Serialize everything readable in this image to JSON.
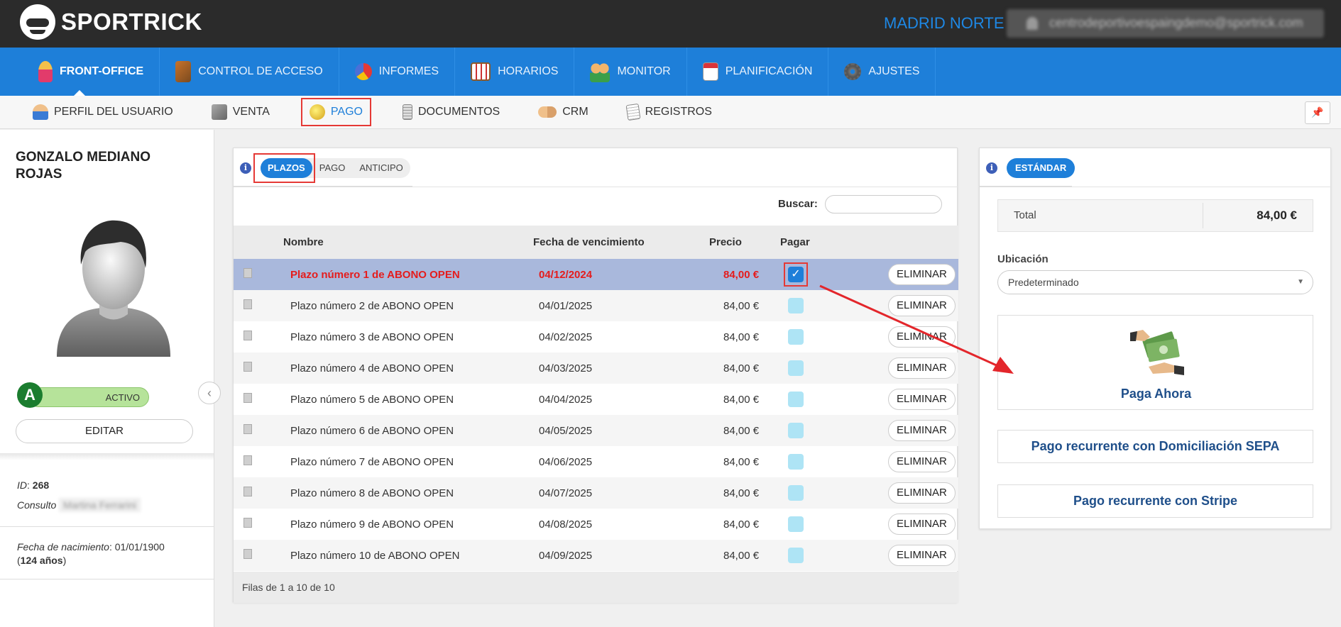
{
  "brand": {
    "name": "SPORTRICK"
  },
  "header": {
    "center_name": "MADRID NORTE",
    "user_email": "centrodeportivoespaingdemo@sportrick.com"
  },
  "main_nav": [
    {
      "label": "FRONT-OFFICE",
      "icon": "user-icon",
      "active": true
    },
    {
      "label": "CONTROL DE ACCESO",
      "icon": "turnstile-icon",
      "active": false
    },
    {
      "label": "INFORMES",
      "icon": "pie-chart-icon",
      "active": false
    },
    {
      "label": "HORARIOS",
      "icon": "calendar-grid-icon",
      "active": false
    },
    {
      "label": "MONITOR",
      "icon": "people-icon",
      "active": false
    },
    {
      "label": "PLANIFICACIÓN",
      "icon": "calendar-icon",
      "active": false
    },
    {
      "label": "AJUSTES",
      "icon": "gear-icon",
      "active": false
    }
  ],
  "sub_nav": [
    {
      "label": "PERFIL DEL USUARIO",
      "icon": "user-icon",
      "active": false
    },
    {
      "label": "VENTA",
      "icon": "cash-register-icon",
      "active": false
    },
    {
      "label": "PAGO",
      "icon": "coin-icon",
      "active": true
    },
    {
      "label": "DOCUMENTOS",
      "icon": "document-icon",
      "active": false
    },
    {
      "label": "CRM",
      "icon": "handshake-icon",
      "active": false
    },
    {
      "label": "REGISTROS",
      "icon": "notepad-icon",
      "active": false
    }
  ],
  "sidebar": {
    "name": "GONZALO MEDIANO ROJAS",
    "status_letter": "A",
    "status_label": "ACTIVO",
    "edit_label": "EDITAR",
    "id_label": "ID",
    "id_value": "268",
    "consultor_label": "Consulto",
    "consultor_value": "Martina Ferrarini",
    "birth_label": "Fecha de nacimiento",
    "birth_value": "01/01/1900",
    "age_value": "124 años"
  },
  "payments": {
    "tabs": [
      "PLAZOS",
      "PAGO",
      "ANTICIPO"
    ],
    "search_label": "Buscar:",
    "columns": [
      "Nombre",
      "Fecha de vencimiento",
      "Precio",
      "Pagar"
    ],
    "delete_label": "ELIMINAR",
    "rows": [
      {
        "name": "Plazo número 1 de ABONO OPEN",
        "due": "04/12/2024",
        "price": "84,00 €",
        "selected": true
      },
      {
        "name": "Plazo número 2 de ABONO OPEN",
        "due": "04/01/2025",
        "price": "84,00 €",
        "selected": false
      },
      {
        "name": "Plazo número 3 de ABONO OPEN",
        "due": "04/02/2025",
        "price": "84,00 €",
        "selected": false
      },
      {
        "name": "Plazo número 4 de ABONO OPEN",
        "due": "04/03/2025",
        "price": "84,00 €",
        "selected": false
      },
      {
        "name": "Plazo número 5 de ABONO OPEN",
        "due": "04/04/2025",
        "price": "84,00 €",
        "selected": false
      },
      {
        "name": "Plazo número 6 de ABONO OPEN",
        "due": "04/05/2025",
        "price": "84,00 €",
        "selected": false
      },
      {
        "name": "Plazo número 7 de ABONO OPEN",
        "due": "04/06/2025",
        "price": "84,00 €",
        "selected": false
      },
      {
        "name": "Plazo número 8 de ABONO OPEN",
        "due": "04/07/2025",
        "price": "84,00 €",
        "selected": false
      },
      {
        "name": "Plazo número 9 de ABONO OPEN",
        "due": "04/08/2025",
        "price": "84,00 €",
        "selected": false
      },
      {
        "name": "Plazo número 10 de ABONO OPEN",
        "due": "04/09/2025",
        "price": "84,00 €",
        "selected": false
      }
    ],
    "footer": "Filas de 1 a 10 de 10"
  },
  "checkout": {
    "tab": "ESTÁNDAR",
    "total_label": "Total",
    "total_value": "84,00 €",
    "location_label": "Ubicación",
    "location_value": "Predeterminado",
    "pay_now_label": "Paga Ahora",
    "sepa_label": "Pago recurrente con Domiciliación SEPA",
    "stripe_label": "Pago recurrente con Stripe"
  },
  "colors": {
    "brand_blue": "#1e7fd9",
    "highlight_red": "#e53935",
    "selected_row": "#a9b8dc",
    "active_green": "#b6e39a"
  }
}
